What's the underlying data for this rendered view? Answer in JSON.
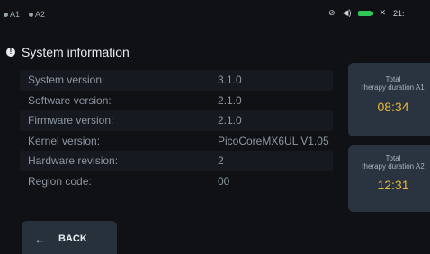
{
  "statusbar": {
    "left_items": [
      "A1",
      "A2"
    ],
    "time_fragment": "21:"
  },
  "header": {
    "title": "System information"
  },
  "info_rows": [
    {
      "label": "System version:",
      "value": "3.1.0"
    },
    {
      "label": "Software version:",
      "value": "2.1.0"
    },
    {
      "label": "Firmware version:",
      "value": "2.1.0"
    },
    {
      "label": "Kernel version:",
      "value": "PicoCoreMX6UL V1.05"
    },
    {
      "label": "Hardware revision:",
      "value": "2"
    },
    {
      "label": "Region code:",
      "value": "00"
    }
  ],
  "cards": [
    {
      "line1": "Total",
      "line2": "therapy duration A1",
      "time": "08:34"
    },
    {
      "line1": "Total",
      "line2": "therapy duration A2",
      "time": "12:31"
    }
  ],
  "back_button": {
    "label": "BACK"
  },
  "colors": {
    "accent_time": "#e9b83a",
    "battery": "#31c65a",
    "card_bg": "#2a3440"
  }
}
